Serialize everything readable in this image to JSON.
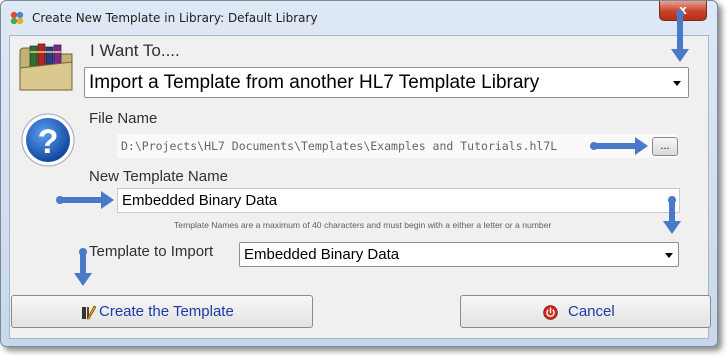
{
  "window": {
    "title": "Create New Template in Library: Default Library",
    "close_glyph": "x"
  },
  "icons": [
    "app-icon",
    "library-books-icon",
    "help-question-icon",
    "create-template-icon",
    "cancel-icon",
    "close-icon",
    "chevron-down-icon"
  ],
  "form": {
    "want_label": "I Want To....",
    "action_value": "Import a Template from another HL7 Template Library",
    "file_label": "File Name",
    "file_value": "D:\\Projects\\HL7 Documents\\Templates\\Examples and Tutorials.hl7L",
    "browse_label": "...",
    "new_name_label": "New Template Name",
    "new_name_value": "Embedded Binary Data",
    "hint": "Template Names are a maximum of 40 characters and must begin with a either a letter or a number",
    "import_label": "Template to Import",
    "import_value": "Embedded Binary Data"
  },
  "buttons": {
    "create_label": "Create the Template",
    "cancel_label": "Cancel"
  },
  "colors": {
    "annotation_arrow": "#4a79c8",
    "button_text": "#1a3aa8",
    "close_button": "#c7402a"
  }
}
